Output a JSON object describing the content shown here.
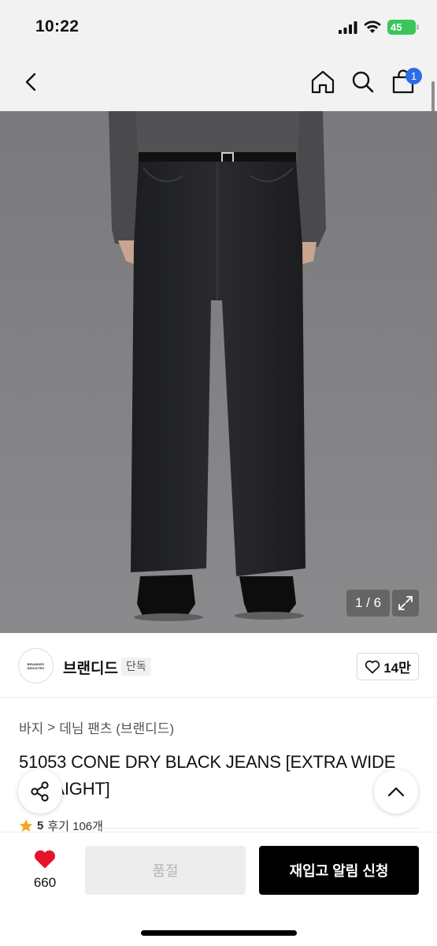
{
  "status_bar": {
    "time": "10:22",
    "battery": "45"
  },
  "nav": {
    "cart_count": "1"
  },
  "gallery": {
    "counter": "1 / 6"
  },
  "brand": {
    "logo_text": "BRANDED INDUSTRY",
    "name": "브랜디드",
    "tag": "단독",
    "likes": "14만"
  },
  "breadcrumb": {
    "level1": "바지",
    "separator": ">",
    "level2": "데님 팬츠 (브랜디드)"
  },
  "product": {
    "title": "51053 CONE DRY BLACK JEANS [EXTRA WIDE STRAIGHT]"
  },
  "rating": {
    "score": "5",
    "reviews": "후기 106개"
  },
  "bottom": {
    "wish_count": "660",
    "soldout_label": "품절",
    "restock_label": "재입고 알림 신청"
  },
  "colors": {
    "accent_blue": "#2d6ce8",
    "heart_red": "#e8132b",
    "star": "#f5a623"
  }
}
